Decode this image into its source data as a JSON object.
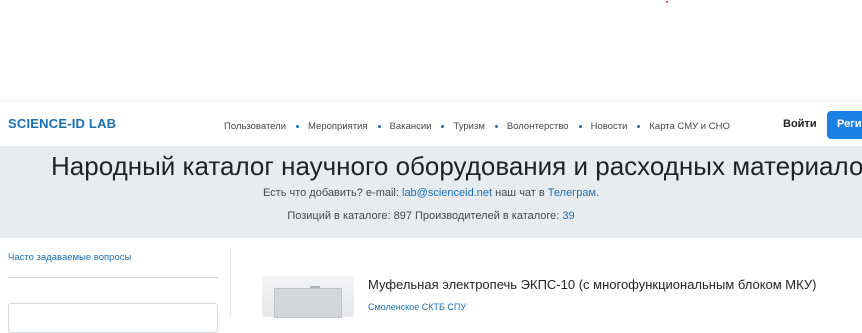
{
  "header": {
    "brand": "SCIENCE-ID LAB",
    "nav": [
      "Пользователи",
      "Мероприятия",
      "Вакансии",
      "Туризм",
      "Волонтерство",
      "Новости",
      "Карта СМУ и СНО"
    ],
    "login_label": "Войти",
    "register_label": "Регистрация"
  },
  "hero": {
    "title": "Народный каталог научного оборудования и расходных материалов",
    "line1_prefix": "Есть что добавить? e-mail: ",
    "email": "lab@scienceid.net",
    "line1_middle": " наш чат в ",
    "telegram": "Телеграм",
    "line1_suffix": ".",
    "items_label": "Позиций в каталоге: ",
    "items_count": "897",
    "makers_label": "Производителей в каталоге: ",
    "makers_count": "39"
  },
  "sidebar": {
    "faq_link": "Часто задаваемые вопросы"
  },
  "product": {
    "title": "Муфельная электропечь ЭКПС-10 (с многофункциональным блоком МКУ)",
    "maker": "Смоленское СКТБ СПУ"
  },
  "colors": {
    "brand": "#1a6fb5",
    "primary_button": "#1b80e4",
    "hero_bg": "#e9ecef"
  }
}
